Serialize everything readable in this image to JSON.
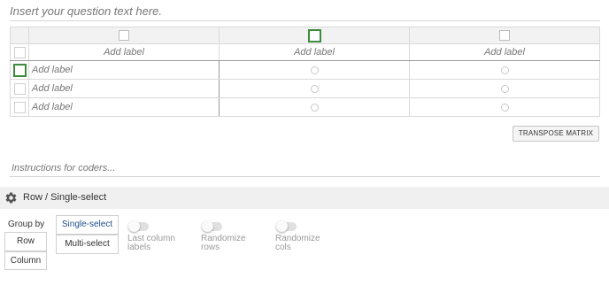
{
  "question": {
    "placeholder": "Insert your question text here."
  },
  "matrix": {
    "columns": [
      {
        "label": "Add label"
      },
      {
        "label": "Add label"
      },
      {
        "label": "Add label"
      }
    ],
    "rows": [
      {
        "label": "Add label"
      },
      {
        "label": "Add label"
      },
      {
        "label": "Add label"
      }
    ],
    "transpose_label": "TRANSPOSE MATRIX"
  },
  "instructions": {
    "placeholder": "Instructions for coders..."
  },
  "panel": {
    "title": "Row / Single-select",
    "icon": "gear-icon",
    "group_by": {
      "label": "Group by",
      "options": [
        "Row",
        "Column"
      ]
    },
    "select_mode": {
      "options": [
        "Single-select",
        "Multi-select"
      ],
      "selected": "Single-select"
    },
    "toggles": [
      {
        "label_line1": "Last column",
        "label_line2": "labels",
        "on": false
      },
      {
        "label_line1": "Randomize",
        "label_line2": "rows",
        "on": false
      },
      {
        "label_line1": "Randomize",
        "label_line2": "cols",
        "on": false
      }
    ]
  },
  "colors": {
    "accent_green": "#3d8b3d",
    "selected_blue": "#1f4e8c",
    "panel_bg": "#f0f0f0"
  }
}
